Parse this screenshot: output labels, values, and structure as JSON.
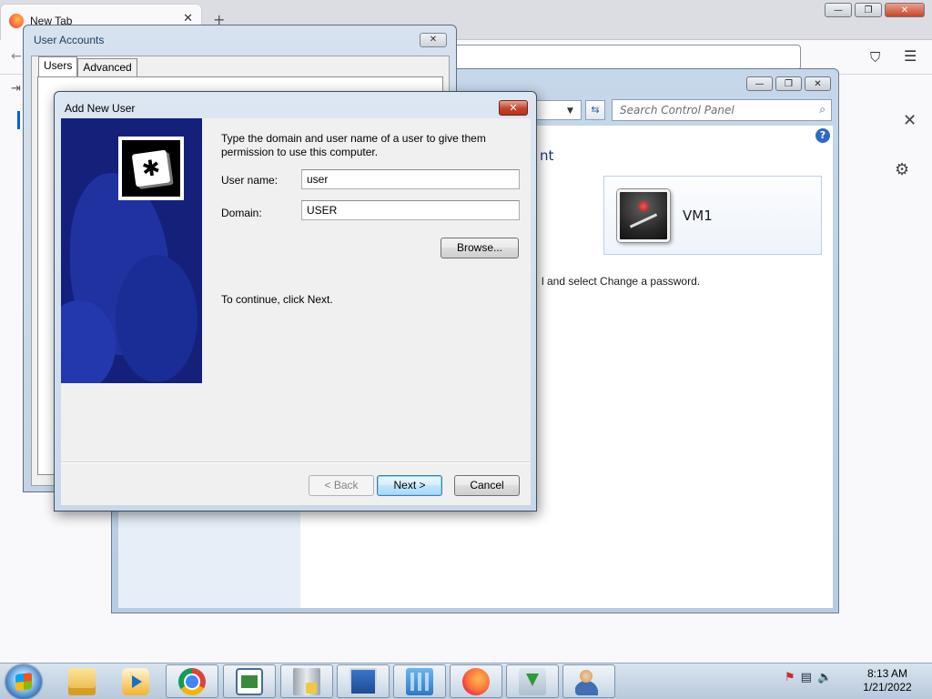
{
  "firefox": {
    "tab_title": "New Tab",
    "tab_close": "✕",
    "new_tab": "+",
    "back": "←",
    "pocket_icon": "⛉",
    "menu_icon": "☰",
    "sidebar_icon": "⇥",
    "infobar_close": "✕",
    "settings_icon": "⚙",
    "window_controls": {
      "minimize": "—",
      "restore": "❐",
      "close": "✕"
    }
  },
  "control_panel": {
    "search_placeholder": "Search Control Panel",
    "search_icon": "⌕",
    "refresh_icon": "⇆",
    "dropdown_icon": "▼",
    "help_icon": "?",
    "heading_fragment": "nt",
    "user_tile_name": "VM1",
    "hint_text": "l and select Change a password.",
    "window_controls": {
      "minimize": "—",
      "restore": "❐",
      "close": "✕"
    }
  },
  "user_accounts": {
    "title": "User Accounts",
    "close_icon": "✕",
    "tabs": [
      {
        "label": "Users",
        "active": true
      },
      {
        "label": "Advanced",
        "active": false
      }
    ]
  },
  "add_new_user": {
    "title": "Add New User",
    "close_icon": "✕",
    "intro": "Type the domain and user name of a user to give them permission to use this computer.",
    "username_label": "User name:",
    "username_value": "user",
    "domain_label": "Domain:",
    "domain_value": "USER",
    "browse_label": "Browse...",
    "continue_text": "To continue, click Next.",
    "back_label": "< Back",
    "next_label": "Next >",
    "cancel_label": "Cancel",
    "banner_logo_icon": "✱"
  },
  "taskbar": {
    "items": [
      {
        "name": "windows-explorer",
        "icon": "folder-icon"
      },
      {
        "name": "media-player",
        "icon": "media-player-icon"
      },
      {
        "name": "chrome",
        "icon": "chrome-icon"
      },
      {
        "name": "window-app",
        "icon": "window-icon"
      },
      {
        "name": "server-manager",
        "icon": "server-icon"
      },
      {
        "name": "remote-desktop",
        "icon": "monitor-icon"
      },
      {
        "name": "control-panel",
        "icon": "control-panel-icon"
      },
      {
        "name": "firefox",
        "icon": "firefox-icon"
      },
      {
        "name": "downloads",
        "icon": "download-icon"
      },
      {
        "name": "user-accounts",
        "icon": "users-icon"
      }
    ],
    "tray": {
      "flag_icon": "⚑",
      "network_icon": "▤",
      "volume_icon": "🔈"
    },
    "clock": {
      "time": "8:13 AM",
      "date": "1/21/2022"
    }
  }
}
